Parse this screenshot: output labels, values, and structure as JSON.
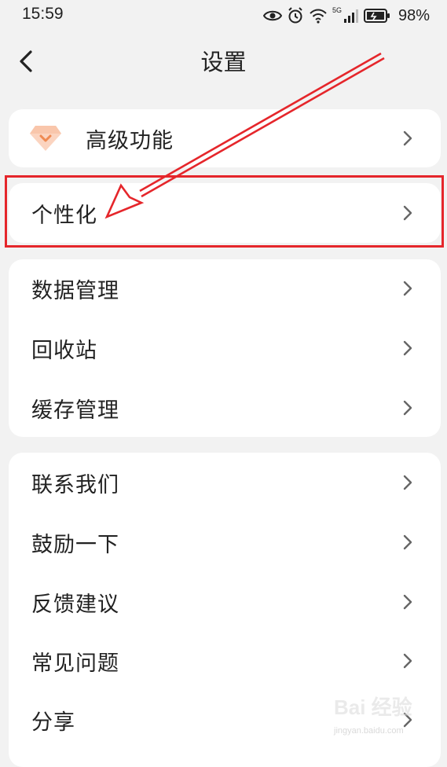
{
  "status_bar": {
    "time": "15:59",
    "network": "5G",
    "battery": "98%"
  },
  "header": {
    "title": "设置"
  },
  "sections": {
    "premium": {
      "label": "高级功能"
    },
    "personalize": {
      "label": "个性化"
    },
    "data": [
      {
        "label": "数据管理"
      },
      {
        "label": "回收站"
      },
      {
        "label": "缓存管理"
      }
    ],
    "support": [
      {
        "label": "联系我们"
      },
      {
        "label": "鼓励一下"
      },
      {
        "label": "反馈建议"
      },
      {
        "label": "常见问题"
      },
      {
        "label": "分享"
      }
    ]
  },
  "watermark": {
    "logo": "Bai 经验",
    "url": "jingyan.baidu.com"
  },
  "colors": {
    "annotation": "#e5262b",
    "background": "#f2f2f2",
    "card": "#ffffff",
    "premium_icon": "#f7b48f"
  }
}
